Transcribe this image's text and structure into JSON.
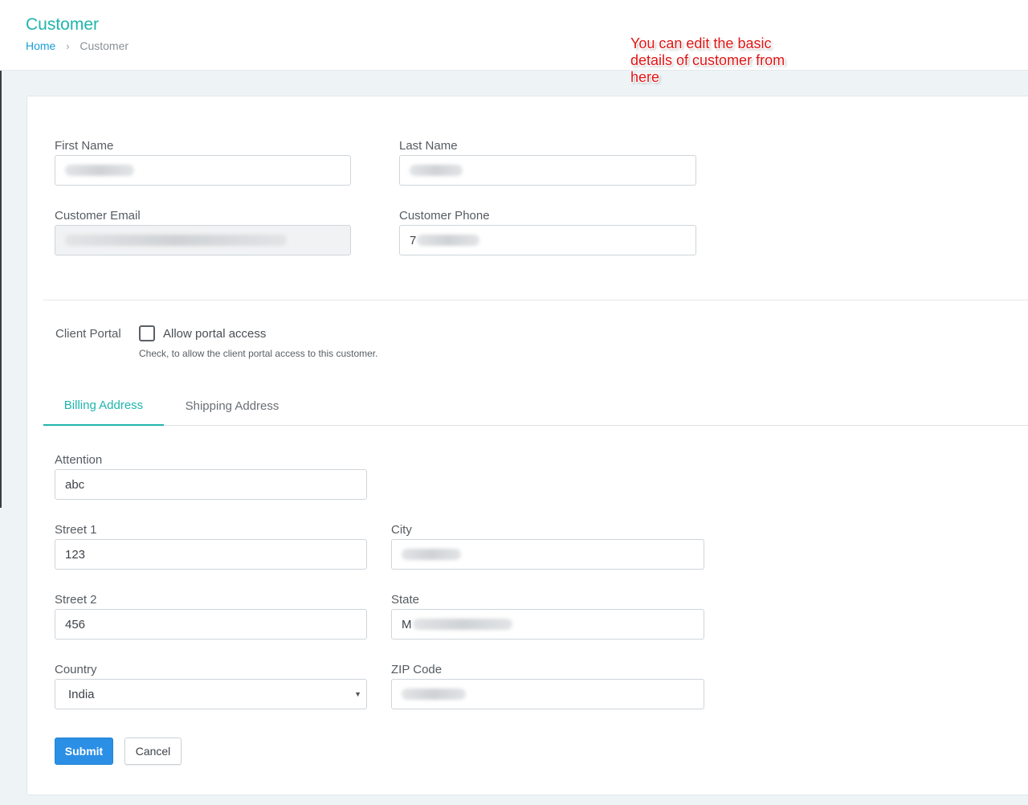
{
  "header": {
    "title": "Customer",
    "breadcrumb": {
      "home": "Home",
      "current": "Customer"
    }
  },
  "annotation": "You can edit the basic details of customer from here",
  "basic": {
    "first_name_label": "First Name",
    "last_name_label": "Last Name",
    "email_label": "Customer Email",
    "phone_label": "Customer Phone",
    "phone_value_visible": "7"
  },
  "portal": {
    "label": "Client Portal",
    "checkbox_label": "Allow portal access",
    "checked": false,
    "help": "Check, to allow the client portal access to this customer."
  },
  "tabs": [
    {
      "label": "Billing Address",
      "active": true
    },
    {
      "label": "Shipping Address",
      "active": false
    }
  ],
  "billing": {
    "attention_label": "Attention",
    "attention_value": "abc",
    "street1_label": "Street 1",
    "street1_value": "123",
    "street2_label": "Street 2",
    "street2_value": "456",
    "city_label": "City",
    "state_label": "State",
    "state_value_visible": "M",
    "country_label": "Country",
    "country_value": "India",
    "zip_label": "ZIP Code"
  },
  "buttons": {
    "submit": "Submit",
    "cancel": "Cancel"
  },
  "colors": {
    "accent": "#1fb5ad",
    "link": "#1a9fd6",
    "primary_button": "#2b8fe6",
    "annotation": "#e01414"
  }
}
